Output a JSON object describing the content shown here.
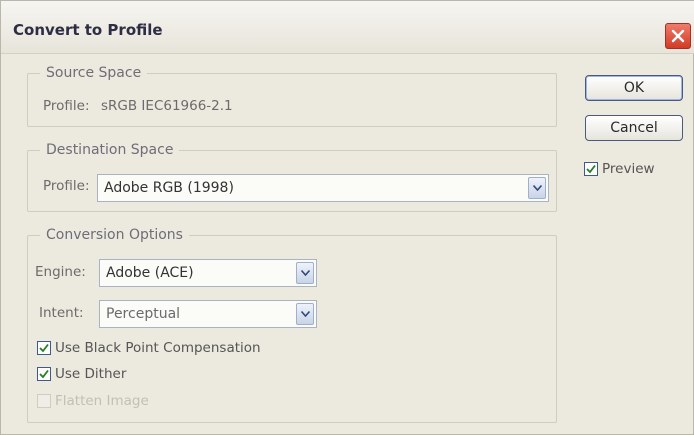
{
  "dialog": {
    "title": "Convert to Profile",
    "buttons": {
      "ok": "OK",
      "cancel": "Cancel"
    },
    "preview": {
      "label": "Preview",
      "checked": true
    }
  },
  "source_space": {
    "legend": "Source Space",
    "profile_label": "Profile:",
    "profile_value": "sRGB IEC61966-2.1"
  },
  "destination_space": {
    "legend": "Destination Space",
    "profile_label": "Profile:",
    "profile_selected": "Adobe RGB (1998)"
  },
  "conversion_options": {
    "legend": "Conversion Options",
    "engine_label": "Engine:",
    "engine_selected": "Adobe (ACE)",
    "intent_label": "Intent:",
    "intent_selected": "Perceptual",
    "checkboxes": [
      {
        "label": "Use Black Point Compensation",
        "checked": true,
        "enabled": true
      },
      {
        "label": "Use Dither",
        "checked": true,
        "enabled": true
      },
      {
        "label": "Flatten Image",
        "checked": false,
        "enabled": false
      }
    ]
  },
  "colors": {
    "close_button": "#d13b27",
    "accent_border": "#3c5a8a"
  }
}
